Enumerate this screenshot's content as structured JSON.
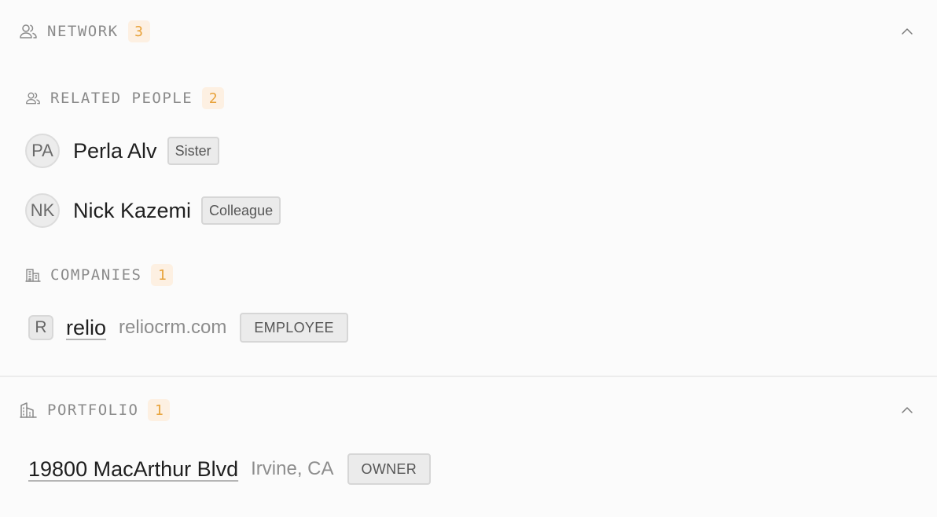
{
  "network": {
    "title": "NETWORK",
    "count": "3",
    "icon": "people-icon",
    "related_people": {
      "title": "RELATED PEOPLE",
      "count": "2",
      "people": [
        {
          "initials": "PA",
          "name": "Perla Alv",
          "relation": "Sister"
        },
        {
          "initials": "NK",
          "name": "Nick Kazemi",
          "relation": "Colleague"
        }
      ]
    },
    "companies": {
      "title": "COMPANIES",
      "count": "1",
      "items": [
        {
          "logo_letter": "R",
          "name": "relio",
          "domain": "reliocrm.com",
          "role": "EMPLOYEE"
        }
      ]
    }
  },
  "portfolio": {
    "title": "PORTFOLIO",
    "count": "1",
    "icon": "buildings-icon",
    "items": [
      {
        "address": "19800 MacArthur Blvd",
        "location": "Irvine, CA",
        "role": "OWNER"
      }
    ]
  },
  "colors": {
    "badge_bg": "#fdf0e2",
    "badge_text": "#e8a23a",
    "label_gray": "#8a8a8a",
    "tag_bg": "#ebebeb"
  }
}
